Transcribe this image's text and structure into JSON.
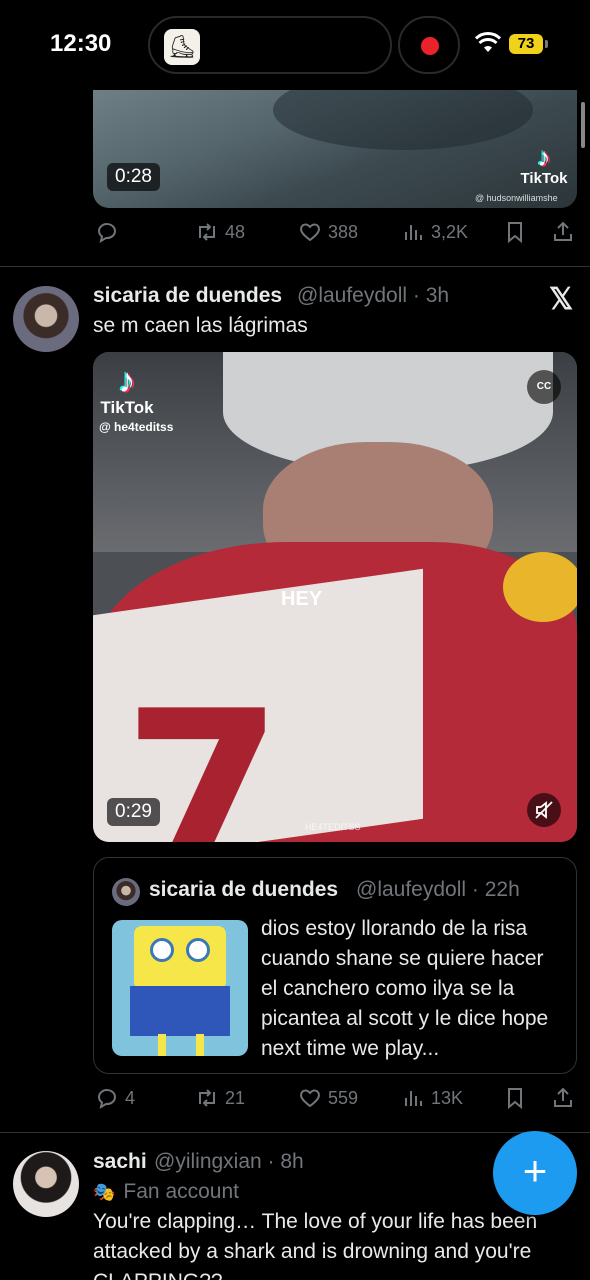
{
  "status": {
    "time": "12:30",
    "battery": "73",
    "record_color": "#e8232a"
  },
  "tweet1": {
    "video": {
      "duration": "0:28",
      "tiktok": "TikTok",
      "tiktok_handle": "@ hudsonwilliamshe"
    },
    "actions": {
      "replies": "",
      "reposts": "48",
      "likes": "388",
      "views": "3,2K"
    }
  },
  "tweet2": {
    "name": "sicaria de duendes",
    "handle": "@laufeydoll · 3h",
    "text": "se m caen las lágrimas",
    "video": {
      "duration": "0:29",
      "tiktok": "TikTok",
      "tiktok_handle": "@ he4teditss",
      "overlay": "HEY",
      "cc": "CC",
      "watermark": "HE4TEDITSS"
    },
    "quote": {
      "name": "sicaria de duendes",
      "handle": "@laufeydoll · 22h",
      "text": "dios estoy llorando de la risa cuando shane se quiere hacer el canchero como ilya se la picantea al scott y le dice hope next time we play..."
    },
    "actions": {
      "replies": "4",
      "reposts": "21",
      "likes": "559",
      "views": "13K"
    }
  },
  "tweet3": {
    "name": "sachi",
    "handle": "@yilingxian · 8h",
    "label": "Fan account",
    "text": "You're clapping… The love of your life has been attacked by a shark and is drowning and you're CLAPPING??"
  },
  "fab": {
    "label": "+"
  },
  "colors": {
    "accent": "#1d9bf0",
    "muted": "#71767b",
    "separator": "#2f3336"
  }
}
